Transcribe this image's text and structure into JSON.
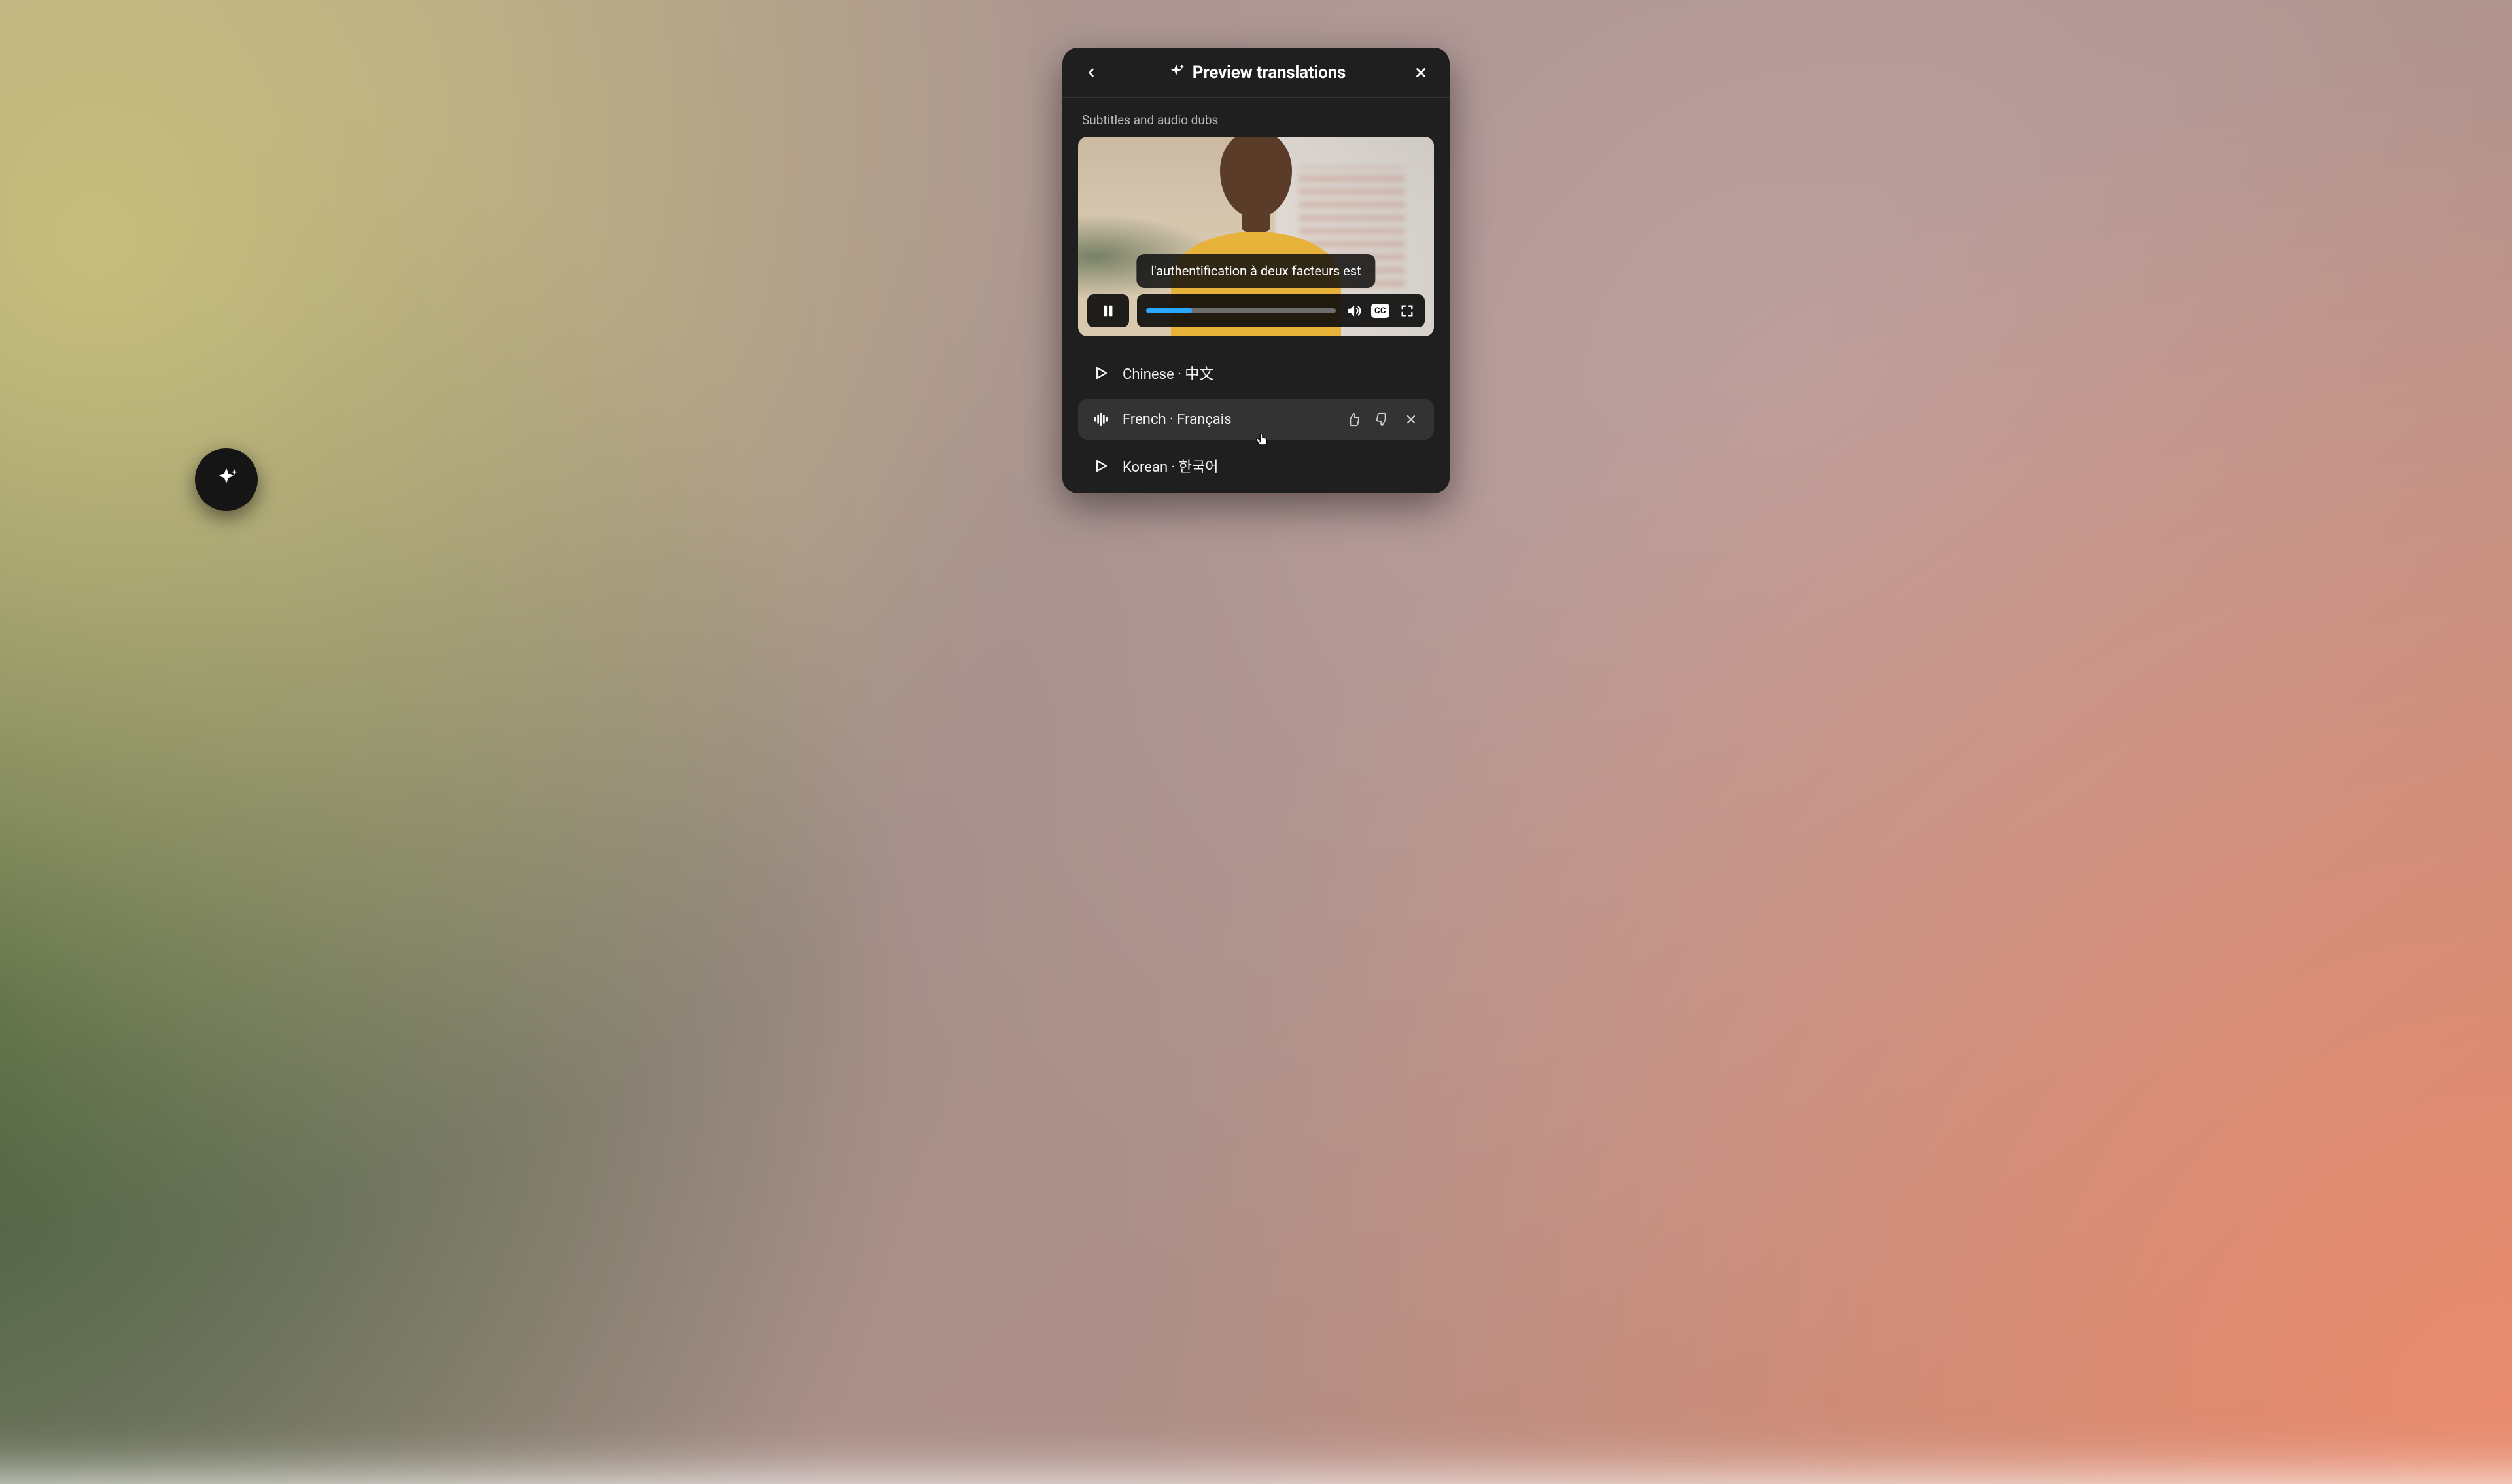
{
  "header": {
    "title": "Preview translations"
  },
  "section": {
    "label": "Subtitles and audio dubs"
  },
  "video": {
    "subtitle": "l'authentification à deux facteurs est",
    "progress_pct": 24,
    "cc_label": "CC"
  },
  "languages": [
    {
      "label": "Chinese · 中文",
      "active": false
    },
    {
      "label": "French · Français",
      "active": true
    },
    {
      "label": "Korean · 한국어",
      "active": false
    }
  ]
}
